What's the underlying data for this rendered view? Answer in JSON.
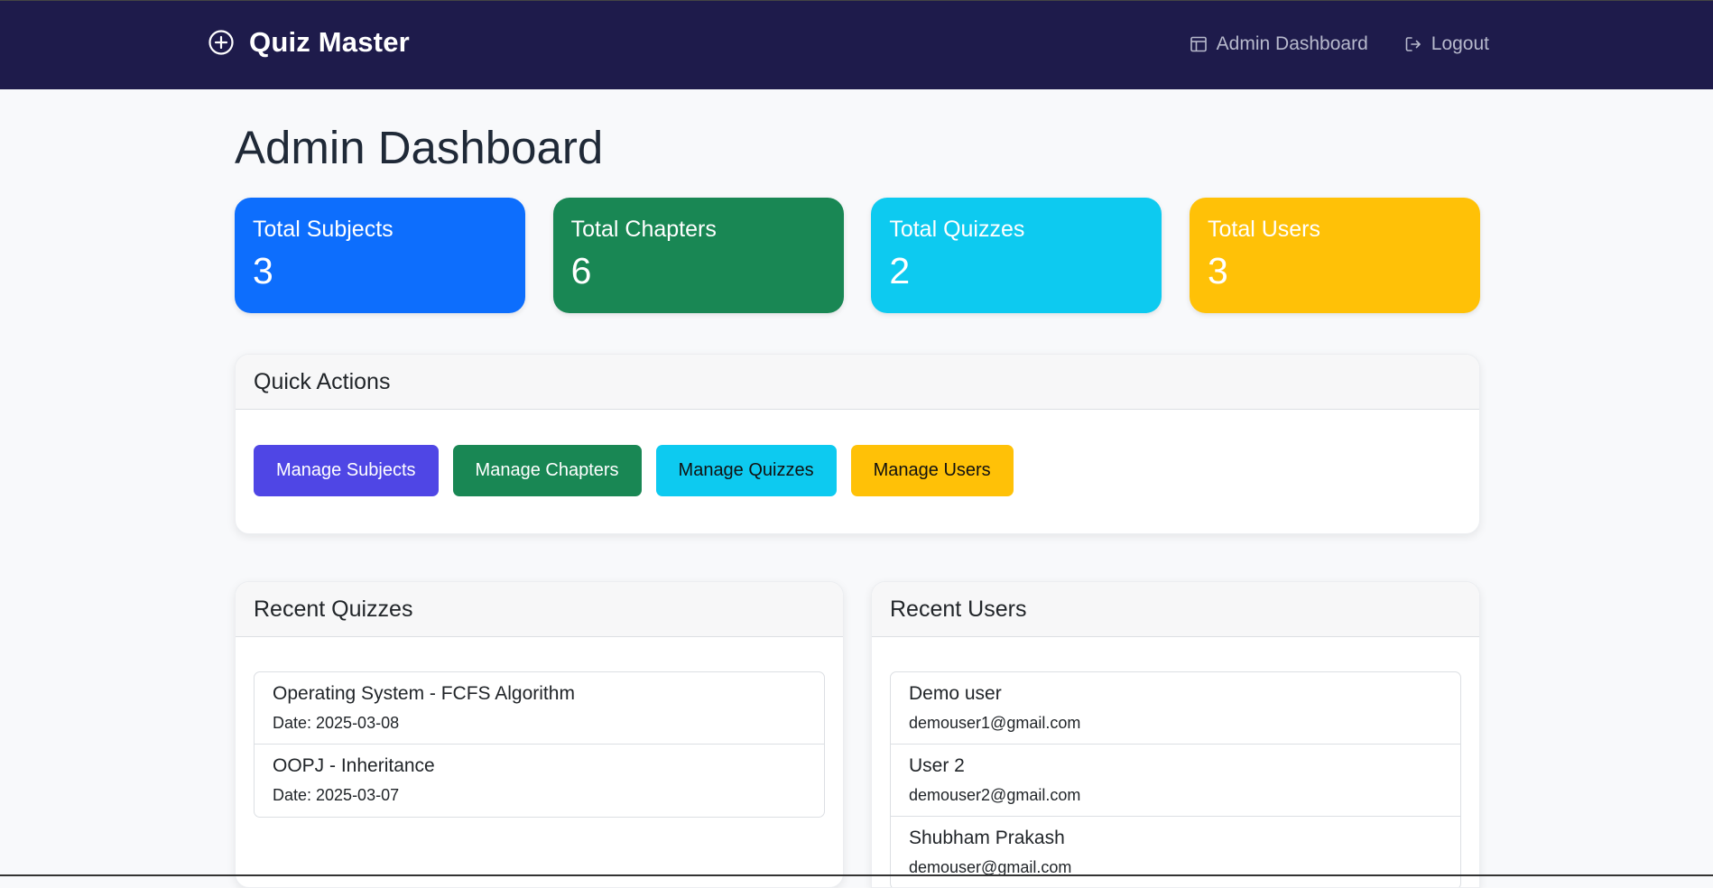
{
  "navbar": {
    "brand": "Quiz Master",
    "links": [
      {
        "label": "Admin Dashboard",
        "icon": "layout-icon"
      },
      {
        "label": "Logout",
        "icon": "logout-icon"
      }
    ],
    "bg_color": "#1e1b4b"
  },
  "page": {
    "title": "Admin Dashboard"
  },
  "stats": [
    {
      "label": "Total Subjects",
      "value": "3",
      "color": "#0d6efd"
    },
    {
      "label": "Total Chapters",
      "value": "6",
      "color": "#198754"
    },
    {
      "label": "Total Quizzes",
      "value": "2",
      "color": "#0dcaf0"
    },
    {
      "label": "Total Users",
      "value": "3",
      "color": "#ffc107"
    }
  ],
  "quick_actions": {
    "title": "Quick Actions",
    "buttons": [
      {
        "label": "Manage Subjects",
        "color": "#4f46e5"
      },
      {
        "label": "Manage Chapters",
        "color": "#198754"
      },
      {
        "label": "Manage Quizzes",
        "color": "#0dcaf0"
      },
      {
        "label": "Manage Users",
        "color": "#ffc107"
      }
    ]
  },
  "recent_quizzes": {
    "title": "Recent Quizzes",
    "items": [
      {
        "title": "Operating System - FCFS Algorithm",
        "sub": "Date: 2025-03-08"
      },
      {
        "title": "OOPJ - Inheritance",
        "sub": "Date: 2025-03-07"
      }
    ]
  },
  "recent_users": {
    "title": "Recent Users",
    "items": [
      {
        "title": "Demo user",
        "sub": "demouser1@gmail.com"
      },
      {
        "title": "User 2",
        "sub": "demouser2@gmail.com"
      },
      {
        "title": "Shubham Prakash",
        "sub": "demouser@gmail.com"
      }
    ]
  }
}
